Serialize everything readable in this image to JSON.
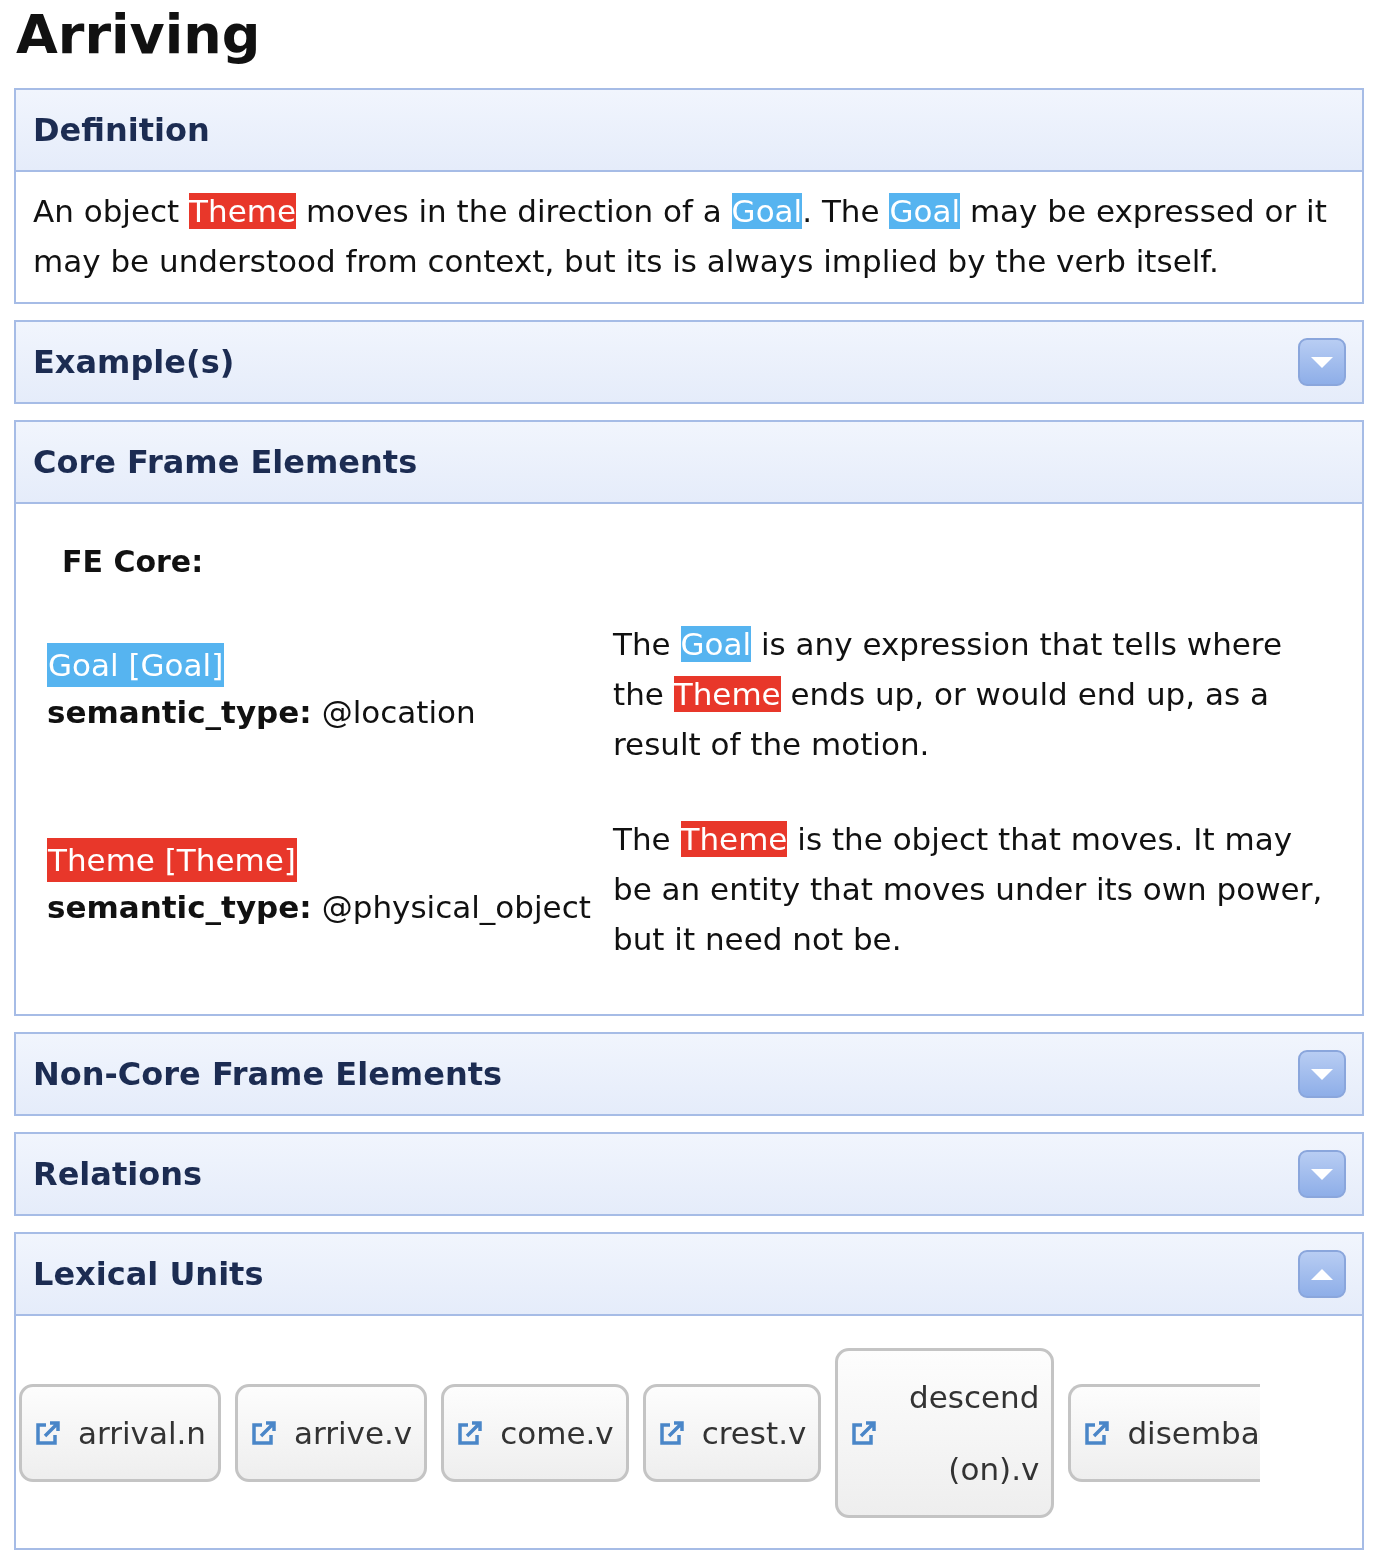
{
  "title": "Arriving",
  "sections": [
    {
      "kind": "definition",
      "title": "Definition",
      "text": [
        {
          "text": "An object "
        },
        {
          "text": "Theme",
          "color": "#e8372a"
        },
        {
          "text": " moves in the direction of a "
        },
        {
          "text": "Goal",
          "color": "#56b4f0"
        },
        {
          "text": ". The "
        },
        {
          "text": "Goal",
          "color": "#56b4f0"
        },
        {
          "text": " may be expressed or it may be understood from context, but its is always implied by the verb itself."
        }
      ]
    },
    {
      "kind": "collapsible",
      "title": "Example(s)",
      "expanded": false
    },
    {
      "kind": "fes",
      "title": "Core Frame Elements",
      "heading": "FE Core:",
      "fes": [
        {
          "name": "Goal [Goal]",
          "color": "#56b4f0",
          "semantic_label": "semantic_type:",
          "semantic_type": "@location",
          "description": [
            {
              "text": "The "
            },
            {
              "text": "Goal",
              "color": "#56b4f0"
            },
            {
              "text": " is any expression that tells where the "
            },
            {
              "text": "Theme",
              "color": "#e8372a"
            },
            {
              "text": " ends up, or would end up, as a result of the motion."
            }
          ]
        },
        {
          "name": "Theme [Theme]",
          "color": "#e8372a",
          "semantic_label": "semantic_type:",
          "semantic_type": "@physical_object",
          "description": [
            {
              "text": "The "
            },
            {
              "text": "Theme",
              "color": "#e8372a"
            },
            {
              "text": " is the object that moves. It may be an entity that moves under its own power, but it need not be."
            }
          ]
        }
      ]
    },
    {
      "kind": "collapsible",
      "title": "Non-Core Frame Elements",
      "expanded": false
    },
    {
      "kind": "collapsible",
      "title": "Relations",
      "expanded": false
    },
    {
      "kind": "lus",
      "title": "Lexical Units",
      "expanded": true,
      "units": [
        {
          "label": "arrival.n",
          "clipped": false
        },
        {
          "label": "arrive.v",
          "clipped": false
        },
        {
          "label": "come.v",
          "clipped": false
        },
        {
          "label": "crest.v",
          "clipped": false
        },
        {
          "label": "descend (on).v",
          "clipped": false
        },
        {
          "label": "disemba",
          "clipped": true
        }
      ]
    }
  ]
}
